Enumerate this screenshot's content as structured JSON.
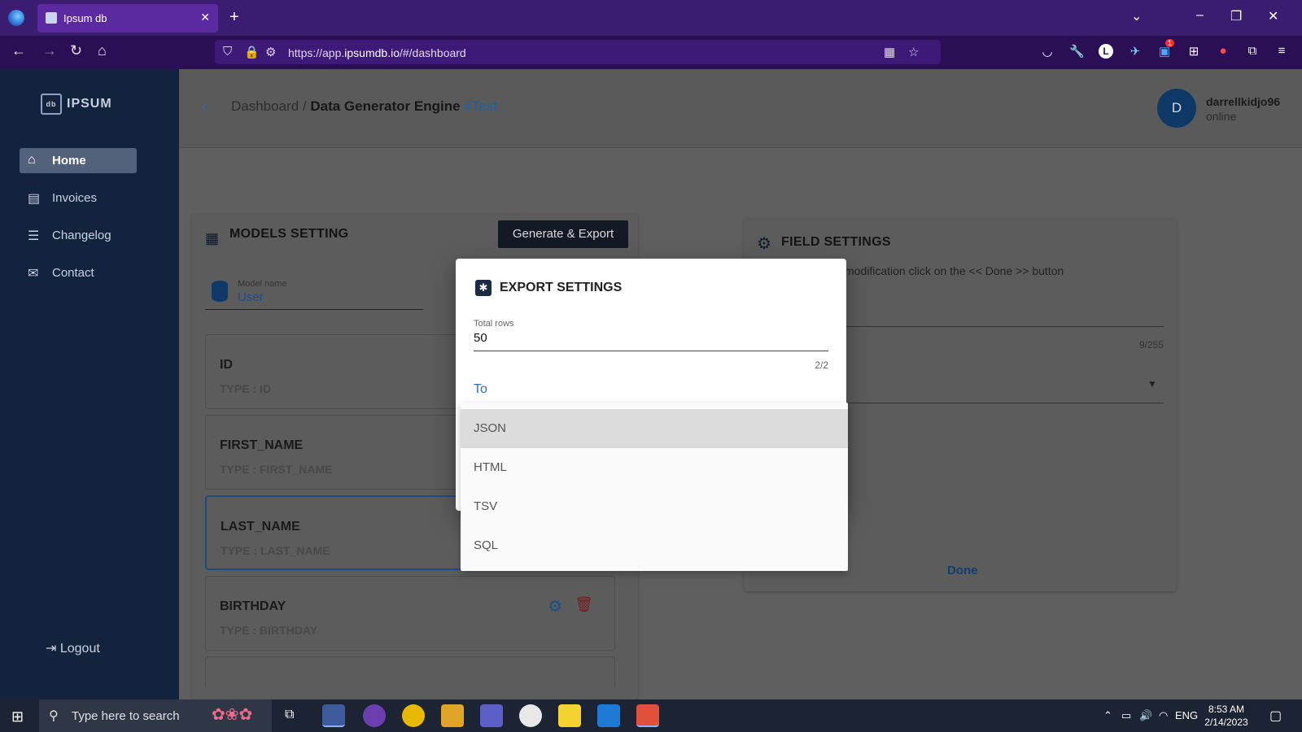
{
  "browser": {
    "tab_title": "Ipsum db",
    "url_prefix": "https://app.",
    "url_domain": "ipsumdb.io",
    "url_suffix": "/#/dashboard",
    "ext_badge": "1"
  },
  "sidebar": {
    "logo_text": "IPSUM",
    "logo_mark": "db",
    "items": [
      {
        "label": "Home",
        "icon": "home-icon"
      },
      {
        "label": "Invoices",
        "icon": "document-icon"
      },
      {
        "label": "Changelog",
        "icon": "list-icon"
      },
      {
        "label": "Contact",
        "icon": "mail-icon"
      }
    ],
    "logout": "Logout"
  },
  "header": {
    "crumb_root": "Dashboard /",
    "crumb_current": "Data Generator Engine",
    "crumb_tag": "#Test",
    "avatar_letter": "D",
    "username": "darrellkidjo96",
    "status": "online"
  },
  "models": {
    "title": "MODELS SETTING",
    "generate_button": "Generate & Export",
    "model_name_label": "Model name",
    "model_name_value": "User",
    "fields": [
      {
        "name": "ID",
        "type": "TYPE : ID"
      },
      {
        "name": "FIRST_NAME",
        "type": "TYPE : FIRST_NAME"
      },
      {
        "name": "LAST_NAME",
        "type": "TYPE : LAST_NAME"
      },
      {
        "name": "BIRTHDAY",
        "type": "TYPE : BIRTHDAY"
      }
    ]
  },
  "field_settings": {
    "title": "FIELD SETTINGS",
    "hint_text": "modification click on the << Done >> button",
    "counter": "9/255",
    "done": "Done"
  },
  "export_modal": {
    "title": "EXPORT SETTINGS",
    "total_rows_label": "Total rows",
    "total_rows_value": "50",
    "rows_counter": "2/2",
    "to_label": "To",
    "options": [
      "JSON",
      "HTML",
      "TSV",
      "SQL"
    ],
    "highlighted_option": "JSON"
  },
  "taskbar": {
    "search_placeholder": "Type here to search",
    "language": "ENG",
    "time": "8:53 AM",
    "date": "2/14/2023"
  }
}
